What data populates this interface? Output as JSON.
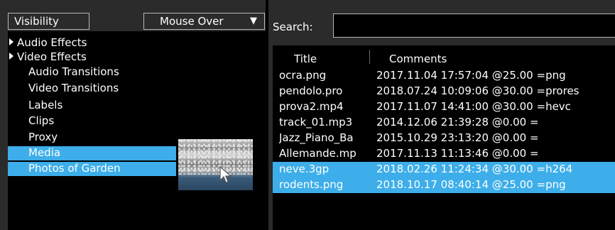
{
  "left_panel": {
    "visibility_label": "Visibility",
    "mouse_over_label": "Mouse Over",
    "dropdown_arrow": "▼",
    "bins": [
      {
        "label": "Audio Effects",
        "expandable": true,
        "selected": false
      },
      {
        "label": "Video Effects",
        "expandable": true,
        "selected": false
      },
      {
        "label": "Audio Transitions",
        "expandable": false,
        "selected": false
      },
      {
        "label": "Video Transitions",
        "expandable": false,
        "selected": false
      },
      {
        "label": "Labels",
        "expandable": false,
        "selected": false
      },
      {
        "label": "Clips",
        "expandable": false,
        "selected": false
      },
      {
        "label": "Proxy",
        "expandable": false,
        "selected": false
      },
      {
        "label": "Media",
        "expandable": false,
        "selected": true
      },
      {
        "label": "Photos of Garden",
        "expandable": false,
        "selected": true
      }
    ]
  },
  "right_panel": {
    "search_label": "Search:",
    "search_value": "",
    "columns": {
      "title": "Title",
      "comments": "Comments"
    },
    "rows": [
      {
        "title": "ocra.png",
        "comment": "2017.11.04 17:57:04 @25.00 =png",
        "selected": false
      },
      {
        "title": "pendolo.pro",
        "comment": "2018.07.24 10:09:06 @30.00 =prores",
        "selected": false
      },
      {
        "title": "prova2.mp4",
        "comment": "2017.11.07 14:41:00 @30.00 =hevc",
        "selected": false
      },
      {
        "title": "track_01.mp3",
        "comment": "2014.12.06 21:39:28 @0.00 =",
        "selected": false
      },
      {
        "title": "Jazz_Piano_Ba",
        "comment": "2015.10.29 23:13:20 @0.00 =",
        "selected": false
      },
      {
        "title": "Allemande.mp",
        "comment": "2017.11.13 11:13:46 @0.00 =",
        "selected": false
      },
      {
        "title": "neve.3gp",
        "comment": "2018.02.26 11:24:34 @30.00 =h264",
        "selected": true
      },
      {
        "title": "rodents.png",
        "comment": "2018.10.17 08:40:14 @25.00 =png",
        "selected": true
      }
    ]
  },
  "colors": {
    "selection": "#3daee9",
    "panel": "#2b2b2b",
    "list_bg": "#000000"
  },
  "icons": {
    "expand": "triangle-right-icon",
    "cursor": "mouse-pointer-icon",
    "thumbnail": "snow-photo-thumbnail"
  }
}
